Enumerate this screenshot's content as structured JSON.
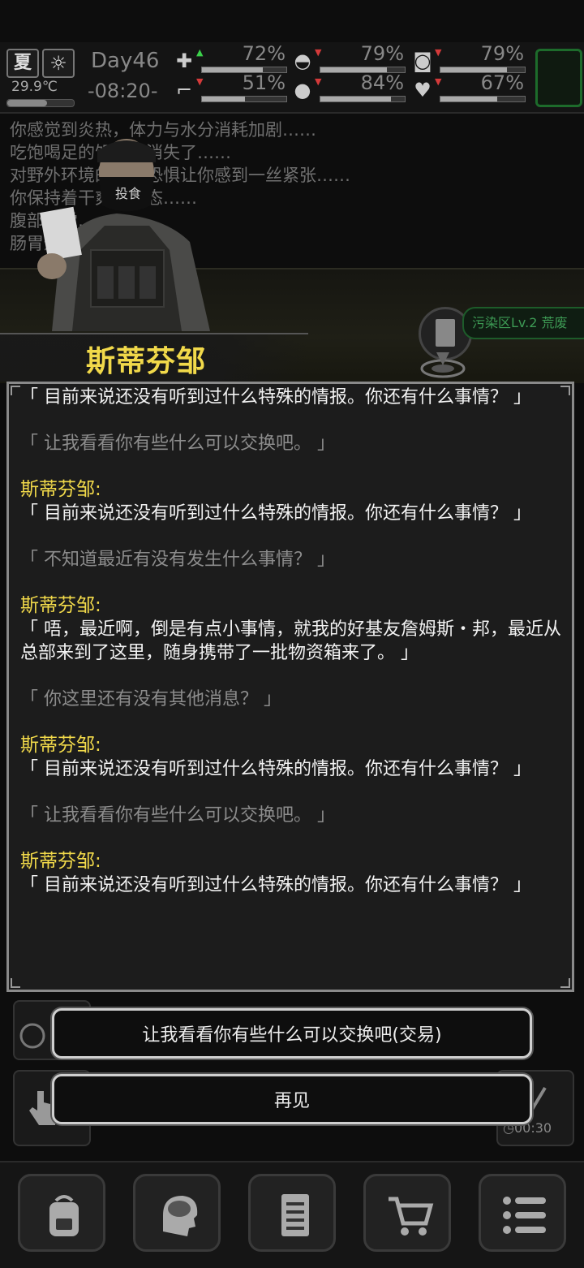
{
  "status": {
    "season": "夏",
    "weather_icon": "sun-icon",
    "temperature": "29.9℃",
    "day": "Day46",
    "time": "-08:20-",
    "stats": [
      {
        "name": "health",
        "icon": "medkit-icon",
        "trend": "up",
        "value": "72%",
        "level": 0.72
      },
      {
        "name": "hunger",
        "icon": "stomach-icon",
        "trend": "down",
        "value": "79%",
        "level": 0.79
      },
      {
        "name": "sanity",
        "icon": "mind-icon",
        "trend": "down",
        "value": "79%",
        "level": 0.79
      },
      {
        "name": "stamina",
        "icon": "boot-icon",
        "trend": "down",
        "value": "51%",
        "level": 0.51
      },
      {
        "name": "thirst",
        "icon": "water-drop-icon",
        "trend": "down",
        "value": "84%",
        "level": 0.84
      },
      {
        "name": "mood",
        "icon": "heart-icon",
        "trend": "down",
        "value": "67%",
        "level": 0.67
      }
    ]
  },
  "log": [
    "你感觉到炎热，体力与水分消耗加剧……",
    "吃饱喝足的饥饿感消失了……",
    "对野外环境的未知恐惧让你感到一丝紧张……",
    "你保持着干爽的状态……",
    "腹部感觉……",
    "肠胃通泰……"
  ],
  "location": {
    "label": "污染区Lv.2 荒废"
  },
  "npc": {
    "name": "斯蒂芬邹",
    "mask_text": "投食"
  },
  "dialog": [
    {
      "speaker": "",
      "type": "npc",
      "text": "「 目前来说还没有听到过什么特殊的情报。你还有什么事情？ 」"
    },
    {
      "speaker": "",
      "type": "player",
      "text": "「 让我看看你有些什么可以交换吧。 」"
    },
    {
      "speaker": "斯蒂芬邹:",
      "type": "npc",
      "text": "「 目前来说还没有听到过什么特殊的情报。你还有什么事情？ 」"
    },
    {
      "speaker": "",
      "type": "player",
      "text": "「 不知道最近有没有发生什么事情？ 」"
    },
    {
      "speaker": "斯蒂芬邹:",
      "type": "npc",
      "text": "「 唔，最近啊，倒是有点小事情，就我的好基友詹姆斯・邦，最近从总部来到了这里，随身携带了一批物资箱来了。 」"
    },
    {
      "speaker": "",
      "type": "player",
      "text": "「 你这里还有没有其他消息？ 」"
    },
    {
      "speaker": "斯蒂芬邹:",
      "type": "npc",
      "text": "「 目前来说还没有听到过什么特殊的情报。你还有什么事情？ 」"
    },
    {
      "speaker": "",
      "type": "player",
      "text": "「 让我看看你有些什么可以交换吧。 」"
    },
    {
      "speaker": "斯蒂芬邹:",
      "type": "npc",
      "text": "「 目前来说还没有听到过什么特殊的情报。你还有什么事情？ 」"
    }
  ],
  "choices": {
    "trade": "让我看看你有些什么可以交换吧(交易)",
    "goodbye": "再见"
  },
  "timer": "00:30",
  "nav": [
    {
      "name": "backpack",
      "icon": "backpack-icon"
    },
    {
      "name": "skills",
      "icon": "brain-icon"
    },
    {
      "name": "journal",
      "icon": "notebook-icon"
    },
    {
      "name": "shop",
      "icon": "cart-icon"
    },
    {
      "name": "menu",
      "icon": "menu-icon"
    }
  ],
  "colors": {
    "accent_yellow": "#f1d94a",
    "location_green": "#3d9a54",
    "trend_up": "#3bd14a",
    "trend_down": "#d43a3a"
  }
}
